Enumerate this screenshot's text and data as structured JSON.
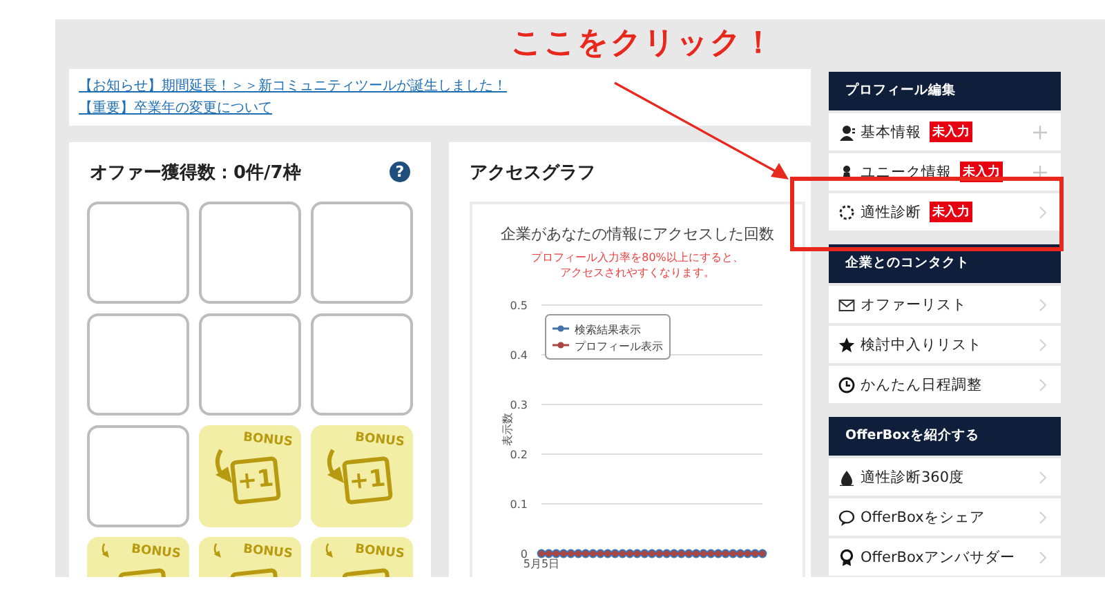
{
  "annotation": {
    "text": "ここをクリック！"
  },
  "notices": [
    {
      "text": "【お知らせ】期間延長！＞＞新コミュニティツールが誕生しました！"
    },
    {
      "text": "【重要】卒業年の変更について"
    }
  ],
  "offers": {
    "title": "オファー獲得数：0件/7枠",
    "help": "?",
    "tiles": [
      {
        "kind": "empty"
      },
      {
        "kind": "empty"
      },
      {
        "kind": "empty"
      },
      {
        "kind": "empty"
      },
      {
        "kind": "empty"
      },
      {
        "kind": "empty"
      },
      {
        "kind": "empty"
      },
      {
        "kind": "bonus",
        "badge": "BONUS",
        "value": "+1"
      },
      {
        "kind": "bonus",
        "badge": "BONUS",
        "value": "+1"
      },
      {
        "kind": "bonus",
        "badge": "BONUS"
      },
      {
        "kind": "bonus",
        "badge": "BONUS"
      },
      {
        "kind": "bonus",
        "badge": "BONUS"
      }
    ]
  },
  "access_graph": {
    "title": "アクセスグラフ",
    "notes": [
      "プロフィール入力率を80%以上にすると、",
      "アクセスされやすくなります。"
    ],
    "chart_data": {
      "type": "line",
      "title": "企業があなたの情報にアクセスした回数",
      "ylabel": "表示数",
      "annotations": [
        "5月5日"
      ],
      "ylim": [
        0,
        0.5
      ],
      "grid": true,
      "legend": true,
      "yticks": [
        {
          "value": 0,
          "label": "0"
        },
        {
          "value": 0.1,
          "label": "0.1"
        },
        {
          "value": 0.2,
          "label": "0.2"
        },
        {
          "value": 0.3,
          "label": "0.3"
        },
        {
          "value": 0.4,
          "label": "0.4"
        },
        {
          "value": 0.5,
          "label": "0.5"
        }
      ],
      "series": [
        {
          "name": "検索結果表示",
          "color": "#4572a7",
          "marker": "circle",
          "values": [
            0,
            0,
            0,
            0,
            0,
            0,
            0,
            0,
            0,
            0,
            0,
            0,
            0,
            0,
            0,
            0,
            0,
            0,
            0,
            0,
            0,
            0,
            0,
            0,
            0,
            0,
            0,
            0,
            0,
            0,
            0
          ]
        },
        {
          "name": "プロフィール表示",
          "color": "#aa4643",
          "marker": "circle",
          "values": [
            0,
            0,
            0,
            0,
            0,
            0,
            0,
            0,
            0,
            0,
            0,
            0,
            0,
            0,
            0,
            0,
            0,
            0,
            0,
            0,
            0,
            0,
            0,
            0,
            0,
            0,
            0,
            0,
            0,
            0,
            0
          ]
        }
      ]
    }
  },
  "sidebar": {
    "sections": [
      {
        "title": "プロフィール編集",
        "items": [
          {
            "kind": "expandable",
            "label": "基本情報",
            "badge": "未入力",
            "highlighted": false
          },
          {
            "kind": "expandable",
            "label": "ユニーク情報",
            "badge": "未入力",
            "highlighted": false
          },
          {
            "kind": "link",
            "label": "適性診断",
            "badge": "未入力",
            "highlighted": true
          }
        ]
      },
      {
        "title": "企業とのコンタクト",
        "items": [
          {
            "kind": "link",
            "label": "オファーリスト",
            "highlighted": false
          },
          {
            "kind": "link",
            "label": "検討中入りリスト",
            "highlighted": false
          },
          {
            "kind": "link",
            "label": "かんたん日程調整",
            "highlighted": false
          }
        ]
      },
      {
        "title": "OfferBoxを紹介する",
        "items": [
          {
            "kind": "link",
            "label": "適性診断360度",
            "highlighted": false
          },
          {
            "kind": "link",
            "label": "OfferBoxをシェア",
            "highlighted": false
          },
          {
            "kind": "link",
            "label": "OfferBoxアンバサダー",
            "highlighted": false
          }
        ]
      }
    ]
  }
}
